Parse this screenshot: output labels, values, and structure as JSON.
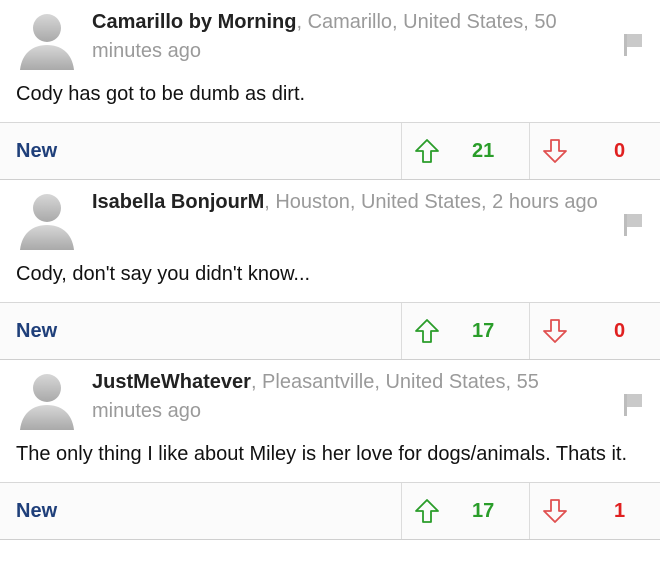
{
  "comments": [
    {
      "author": "Camarillo by Morning",
      "location_time": ", Camarillo, United States, 50 minutes ago",
      "text": "Cody has got to be dumb as dirt.",
      "new_label": "New",
      "up_votes": "21",
      "down_votes": "0"
    },
    {
      "author": "Isabella BonjourM",
      "location_time": ", Houston, United States, 2 hours ago",
      "text": "Cody, don't say you didn't know...",
      "new_label": "New",
      "up_votes": "17",
      "down_votes": "0"
    },
    {
      "author": "JustMeWhatever",
      "location_time": ", Pleasantville, United States, 55 minutes ago",
      "text": "The only thing I like about Miley is her love for dogs/animals. Thats it.",
      "new_label": "New",
      "up_votes": "17",
      "down_votes": "1"
    }
  ],
  "colors": {
    "author": "#222222",
    "meta": "#9a9a9a",
    "new_link": "#1f3f7a",
    "up_vote": "#2a9d2a",
    "down_vote": "#e02020"
  },
  "icons": {
    "avatar": "avatar-silhouette-icon",
    "flag": "flag-icon",
    "up": "arrow-up-icon",
    "down": "arrow-down-icon"
  }
}
